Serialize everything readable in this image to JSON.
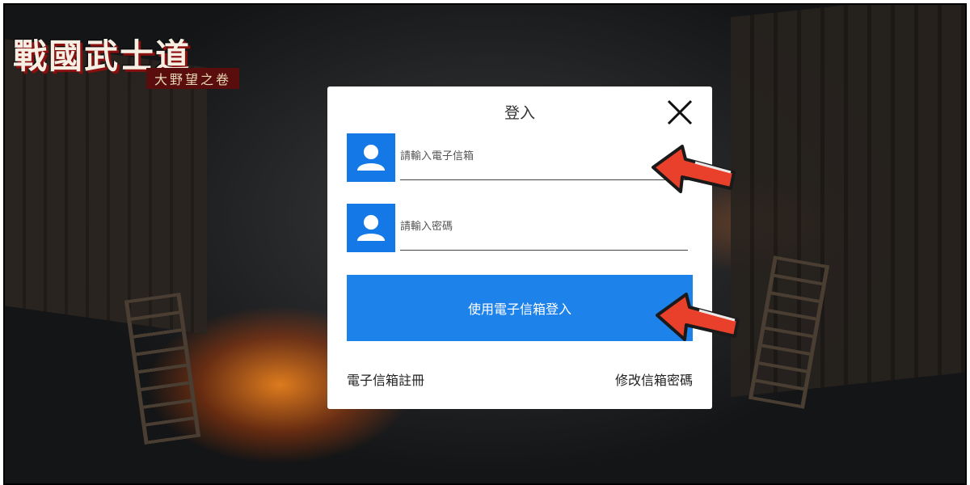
{
  "logo": {
    "title": "戰國武士道",
    "subtitle": "大野望之卷"
  },
  "login_modal": {
    "title": "登入",
    "close_icon": "close-icon",
    "email_field": {
      "placeholder": "請輸入電子信箱",
      "value": "",
      "icon": "user-icon"
    },
    "password_field": {
      "placeholder": "請輸入密碼",
      "value": "",
      "icon": "user-icon"
    },
    "login_button_label": "使用電子信箱登入",
    "register_link": "電子信箱註冊",
    "change_password_link": "修改信箱密碼"
  },
  "annotations": {
    "arrow_color": "#e8402a",
    "arrow_icon": "pointing-arrow-icon"
  },
  "colors": {
    "accent": "#1d82ea",
    "avatar_box": "#1479e6"
  }
}
